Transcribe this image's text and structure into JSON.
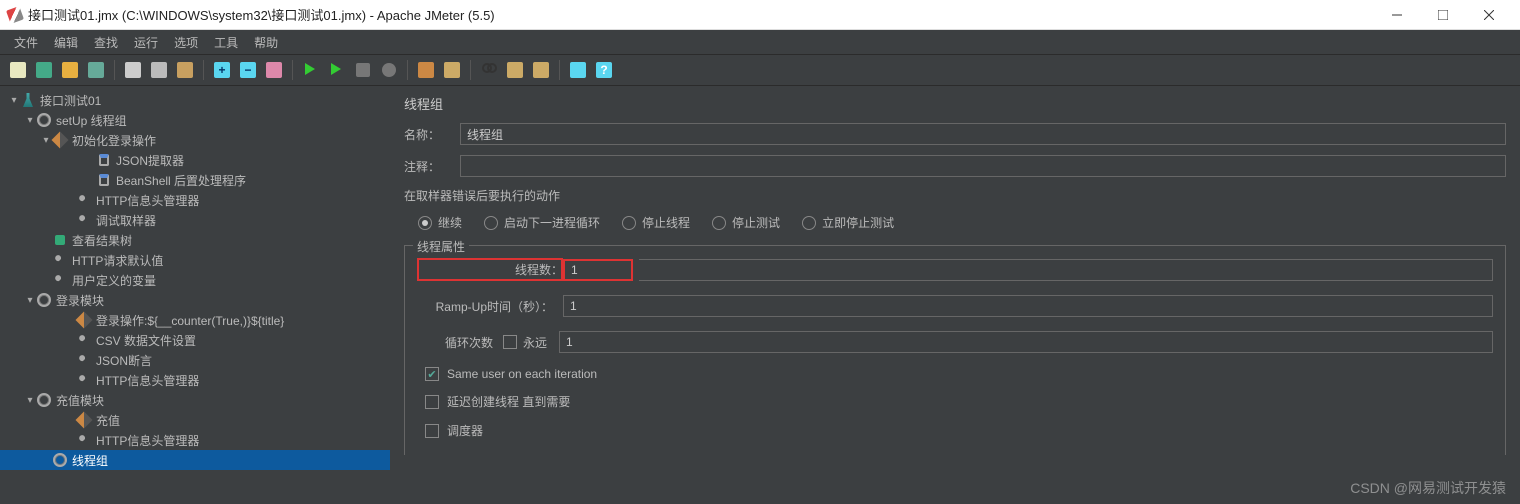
{
  "titlebar": {
    "title": "接口测试01.jmx (C:\\WINDOWS\\system32\\接口测试01.jmx) - Apache JMeter (5.5)"
  },
  "menus": [
    "文件",
    "编辑",
    "查找",
    "运行",
    "选项",
    "工具",
    "帮助"
  ],
  "toolbar_icons": [
    "new",
    "templates",
    "open",
    "save",
    "",
    "cut",
    "copy",
    "paste",
    "",
    "add",
    "remove",
    "edit",
    "",
    "run",
    "run-no-pause",
    "stop",
    "shutdown",
    "",
    "beanshell",
    "fn-helper",
    "",
    "search",
    "clear",
    "clear-all",
    "",
    "toggle-log",
    "help"
  ],
  "tree": [
    {
      "pad": 0,
      "caret": "▾",
      "icon": "flask",
      "label": "接口测试01"
    },
    {
      "pad": 1,
      "caret": "▾",
      "icon": "gear",
      "label": "setUp 线程组"
    },
    {
      "pad": 2,
      "caret": "▾",
      "icon": "pencil",
      "label": "初始化登录操作"
    },
    {
      "pad": 4,
      "caret": "",
      "icon": "clip",
      "label": "JSON提取器"
    },
    {
      "pad": 4,
      "caret": "",
      "icon": "clip",
      "label": "BeanShell 后置处理程序"
    },
    {
      "pad": 3,
      "caret": "",
      "icon": "wrench",
      "label": "HTTP信息头管理器"
    },
    {
      "pad": 3,
      "caret": "",
      "icon": "wrench",
      "label": "调试取样器"
    },
    {
      "pad": 2,
      "caret": "",
      "icon": "node",
      "label": "查看结果树"
    },
    {
      "pad": 2,
      "caret": "",
      "icon": "wrench",
      "label": "HTTP请求默认值"
    },
    {
      "pad": 2,
      "caret": "",
      "icon": "wrench",
      "label": "用户定义的变量"
    },
    {
      "pad": 1,
      "caret": "▾",
      "icon": "gear",
      "label": "登录模块"
    },
    {
      "pad": 3,
      "caret": "",
      "icon": "pencil",
      "label": "登录操作:${__counter(True,)}${title}"
    },
    {
      "pad": 3,
      "caret": "",
      "icon": "wrench",
      "label": "CSV 数据文件设置"
    },
    {
      "pad": 3,
      "caret": "",
      "icon": "wrench",
      "label": "JSON断言"
    },
    {
      "pad": 3,
      "caret": "",
      "icon": "wrench",
      "label": "HTTP信息头管理器"
    },
    {
      "pad": 1,
      "caret": "▾",
      "icon": "gear",
      "label": "充值模块"
    },
    {
      "pad": 3,
      "caret": "",
      "icon": "pencil",
      "label": "充值"
    },
    {
      "pad": 3,
      "caret": "",
      "icon": "wrench",
      "label": "HTTP信息头管理器"
    },
    {
      "pad": 2,
      "caret": "",
      "icon": "gear",
      "label": "线程组",
      "selected": true
    }
  ],
  "panel": {
    "heading": "线程组",
    "name_label": "名称：",
    "name_value": "线程组",
    "comment_label": "注释：",
    "comment_value": "",
    "error_label": "在取样器错误后要执行的动作",
    "radios": [
      "继续",
      "启动下一进程循环",
      "停止线程",
      "停止测试",
      "立即停止测试"
    ],
    "radio_selected": 0,
    "props_legend": "线程属性",
    "threads_label": "线程数：",
    "threads_value": "1",
    "ramp_label": "Ramp-Up时间（秒）：",
    "ramp_value": "1",
    "loop_label": "循环次数",
    "forever_label": "永远",
    "loop_value": "1",
    "cb_same_user": "Same user on each iteration",
    "cb_delay": "延迟创建线程 直到需要",
    "cb_scheduler": "调度器"
  },
  "watermark": "CSDN @网易测试开发猿"
}
